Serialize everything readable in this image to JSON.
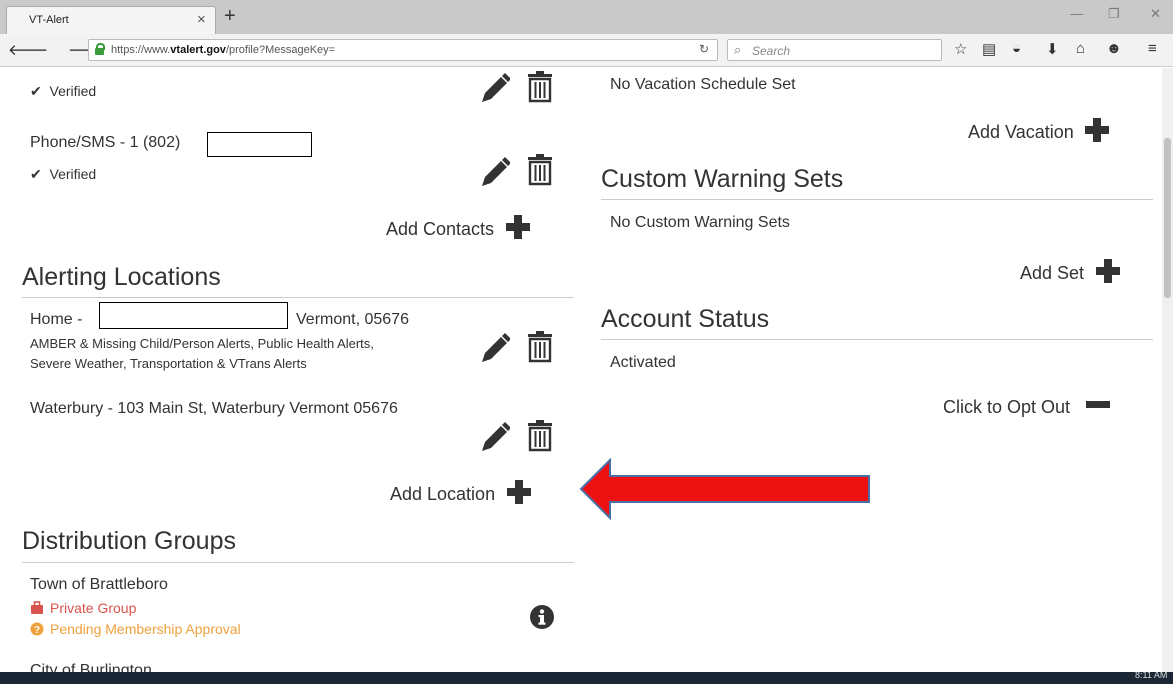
{
  "browser": {
    "tab_title": "VT-Alert",
    "tab_close": "×",
    "new_tab": "+",
    "url_prefix": "https://www.",
    "url_domain": "vtalert.gov",
    "url_path": "/profile?MessageKey=",
    "search_placeholder": "Search",
    "icons": [
      "back-icon",
      "forward-icon",
      "lock-icon",
      "reload-icon",
      "search-icon",
      "bookmark-star-icon",
      "reading-list-icon",
      "pocket-icon",
      "download-icon",
      "home-icon",
      "chat-icon",
      "menu-icon"
    ]
  },
  "left": {
    "contact_1": {
      "status": "Verified"
    },
    "contact_2": {
      "label": "Phone/SMS - 1 (802)",
      "status": "Verified"
    },
    "add_contacts": "Add Contacts",
    "alerting_locations": {
      "heading": "Alerting Locations",
      "locations": [
        {
          "name": "Home - ",
          "address_tail": "Vermont, 05676",
          "alerts_line1": "AMBER & Missing Child/Person Alerts, Public Health Alerts,",
          "alerts_line2": "Severe Weather, Transportation & VTrans Alerts"
        },
        {
          "name": "Waterbury - 103 Main St, Waterbury Vermont 05676"
        }
      ],
      "add_location": "Add Location"
    },
    "distribution_groups": {
      "heading": "Distribution Groups",
      "groups": [
        {
          "name": "Town of Brattleboro",
          "privacy": "Private Group",
          "status": "Pending Membership Approval"
        },
        {
          "name": "City of Burlington"
        }
      ]
    }
  },
  "right": {
    "vacation": {
      "empty_text": "No Vacation Schedule Set",
      "add_label": "Add Vacation"
    },
    "custom_warning_sets": {
      "heading": "Custom Warning Sets",
      "empty_text": "No Custom Warning Sets",
      "add_label": "Add Set"
    },
    "account_status": {
      "heading": "Account Status",
      "value": "Activated",
      "opt_out_label": "Click to Opt Out"
    }
  },
  "taskbar": {
    "time": "8:11 AM"
  },
  "colors": {
    "annotation_arrow": "#ee1111",
    "arrow_outline": "#4a6fa5",
    "private_red": "#d9534f",
    "pending_orange": "#f0a03c",
    "verified_dark": "#333333"
  }
}
